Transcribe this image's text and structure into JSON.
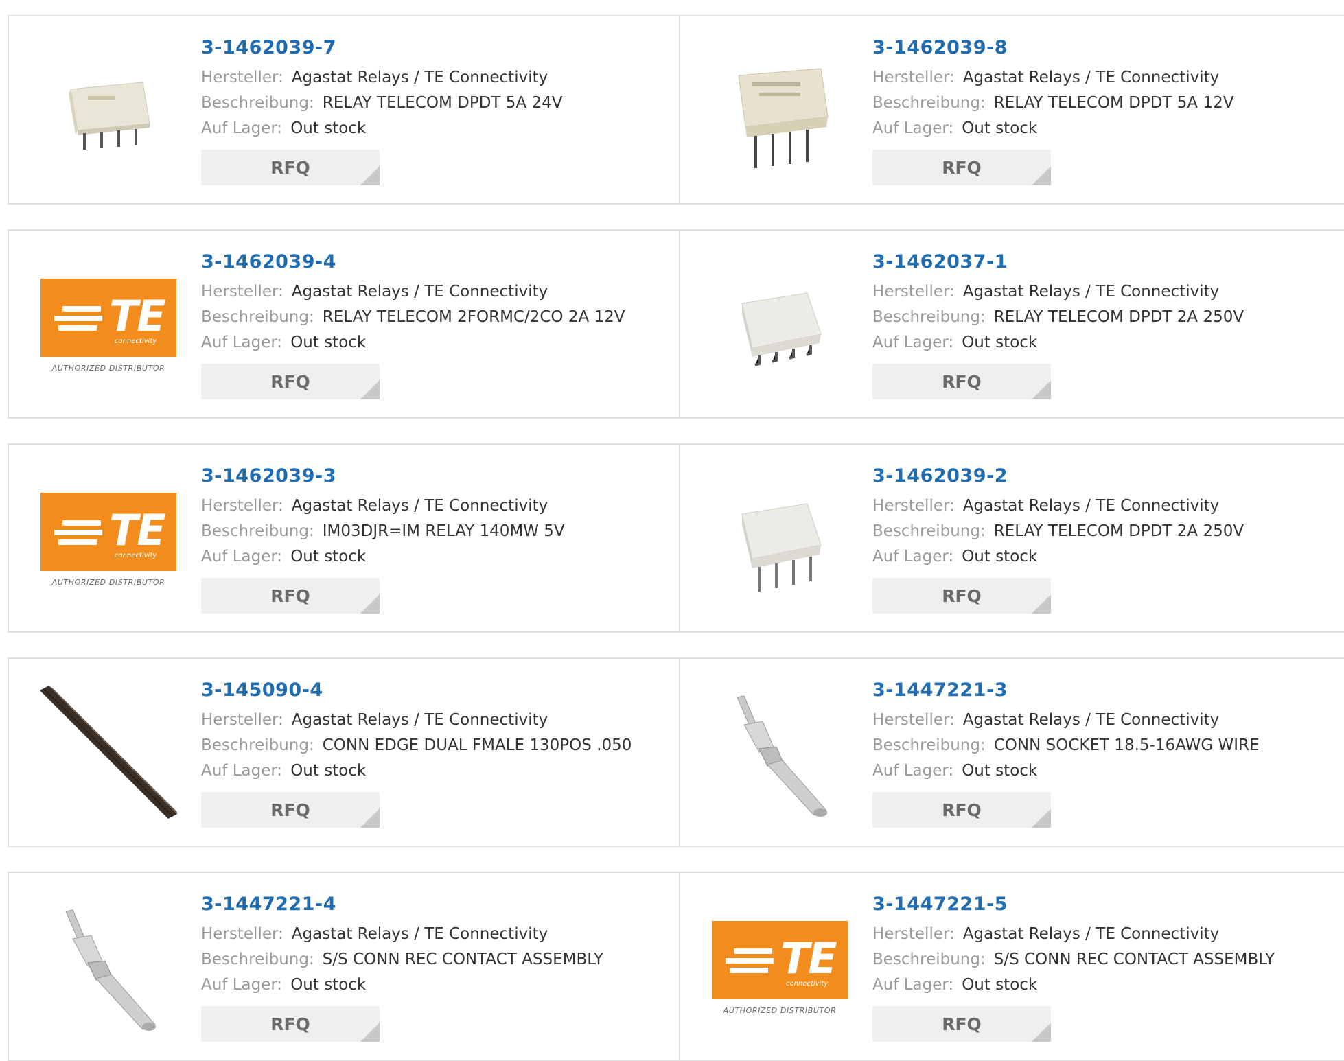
{
  "labels": {
    "hersteller": "Hersteller:",
    "beschreibung": "Beschreibung:",
    "auf_lager": "Auf Lager:",
    "rfq": "RFQ"
  },
  "logo": {
    "te_text": "TE",
    "te_sub": "connectivity",
    "authorized": "AUTHORIZED DISTRIBUTOR"
  },
  "products": [
    {
      "part": "3-1462039-7",
      "manufacturer": "Agastat Relays / TE Connectivity",
      "description": "RELAY TELECOM DPDT 5A 24V",
      "stock": "Out stock",
      "image": "relay-flat"
    },
    {
      "part": "3-1462039-8",
      "manufacturer": "Agastat Relays / TE Connectivity",
      "description": "RELAY TELECOM DPDT 5A 12V",
      "stock": "Out stock",
      "image": "relay-tall"
    },
    {
      "part": "3-1462039-4",
      "manufacturer": "Agastat Relays / TE Connectivity",
      "description": "RELAY TELECOM 2FORMC/2CO 2A 12V",
      "stock": "Out stock",
      "image": "te-logo"
    },
    {
      "part": "3-1462037-1",
      "manufacturer": "Agastat Relays / TE Connectivity",
      "description": "RELAY TELECOM DPDT 2A 250V",
      "stock": "Out stock",
      "image": "relay-smd"
    },
    {
      "part": "3-1462039-3",
      "manufacturer": "Agastat Relays / TE Connectivity",
      "description": "IM03DJR=IM RELAY 140MW 5V",
      "stock": "Out stock",
      "image": "te-logo"
    },
    {
      "part": "3-1462039-2",
      "manufacturer": "Agastat Relays / TE Connectivity",
      "description": "RELAY TELECOM DPDT 2A 250V",
      "stock": "Out stock",
      "image": "relay-tht"
    },
    {
      "part": "3-145090-4",
      "manufacturer": "Agastat Relays / TE Connectivity",
      "description": "CONN EDGE DUAL FMALE 130POS .050",
      "stock": "Out stock",
      "image": "edge-connector"
    },
    {
      "part": "3-1447221-3",
      "manufacturer": "Agastat Relays / TE Connectivity",
      "description": "CONN SOCKET 18.5-16AWG WIRE",
      "stock": "Out stock",
      "image": "contact-pin"
    },
    {
      "part": "3-1447221-4",
      "manufacturer": "Agastat Relays / TE Connectivity",
      "description": "S/S CONN REC CONTACT ASSEMBLY",
      "stock": "Out stock",
      "image": "contact-pin"
    },
    {
      "part": "3-1447221-5",
      "manufacturer": "Agastat Relays / TE Connectivity",
      "description": "S/S CONN REC CONTACT ASSEMBLY",
      "stock": "Out stock",
      "image": "te-logo"
    }
  ]
}
